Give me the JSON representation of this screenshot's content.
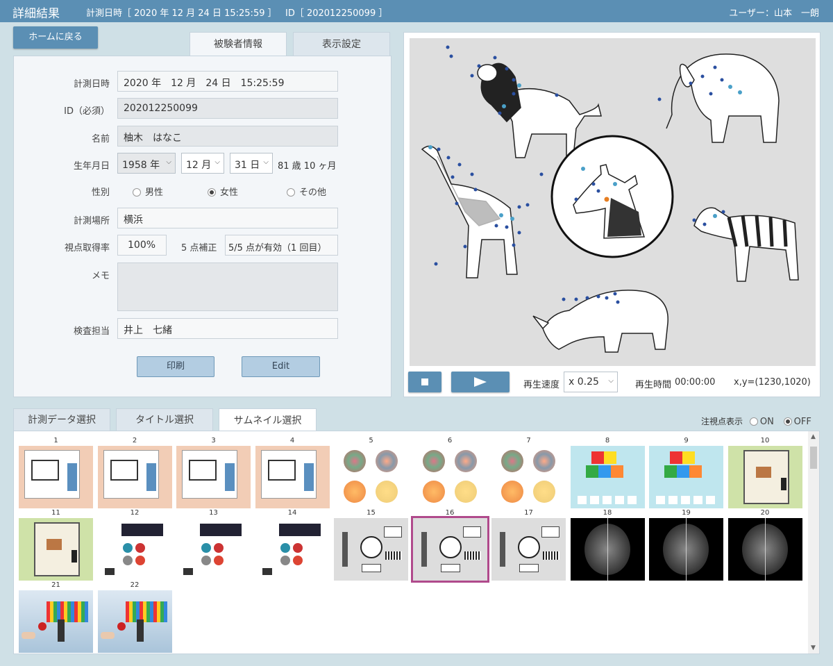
{
  "header": {
    "title": "詳細結果",
    "datetime_label": "計測日時［ 2020 年 12 月 24 日 15:25:59 ］",
    "id_label": "ID［ 202012250099 ］",
    "user_label": "ユーザー：山本　一朗"
  },
  "nav": {
    "home_button": "ホームに戻る"
  },
  "info_tabs": {
    "subject": "被験者情報",
    "display": "表示設定"
  },
  "form": {
    "datetime_label": "計測日時",
    "datetime_value": "2020 年　12 月　24 日　15:25:59",
    "id_label": "ID（必須）",
    "id_value": "202012250099",
    "name_label": "名前",
    "name_value": "柚木　はなこ",
    "birth_label": "生年月日",
    "birth_year": "1958 年",
    "birth_month": "12 月",
    "birth_day": "31 日",
    "age": "81 歳 10 ヶ月",
    "gender_label": "性別",
    "gender_male": "男性",
    "gender_female": "女性",
    "gender_other": "その他",
    "place_label": "計測場所",
    "place_value": "横浜",
    "rate_label": "視点取得率",
    "rate_value": "100%",
    "calib_label": "5 点補正",
    "calib_value": "5/5 点が有効（1 回目）",
    "memo_label": "メモ",
    "memo_value": "",
    "staff_label": "検査担当",
    "staff_value": "井上　七緒",
    "print_button": "印刷",
    "edit_button": "Edit"
  },
  "player": {
    "speed_label": "再生速度",
    "speed_value": "x 0.25",
    "time_label": "再生時間",
    "time_value": "00:00:00",
    "coord_value": "x,y=(1230,1020)"
  },
  "bottom_tabs": {
    "data": "計測データ選択",
    "title": "タイトル選択",
    "thumb": "サムネイル選択"
  },
  "gaze_toggle": {
    "label": "注視点表示",
    "on": "ON",
    "off": "OFF",
    "selected": "OFF"
  },
  "thumbnails": [
    {
      "num": "1"
    },
    {
      "num": "2"
    },
    {
      "num": "3"
    },
    {
      "num": "4"
    },
    {
      "num": "5"
    },
    {
      "num": "6"
    },
    {
      "num": "7"
    },
    {
      "num": "8"
    },
    {
      "num": "9"
    },
    {
      "num": "10"
    },
    {
      "num": "11"
    },
    {
      "num": "12"
    },
    {
      "num": "13"
    },
    {
      "num": "14"
    },
    {
      "num": "15"
    },
    {
      "num": "16"
    },
    {
      "num": "17"
    },
    {
      "num": "18"
    },
    {
      "num": "19"
    },
    {
      "num": "20"
    },
    {
      "num": "21"
    },
    {
      "num": "22"
    }
  ],
  "selected_thumbnail": "16",
  "colors": {
    "header": "#5b8fb4",
    "accent": "#b04a8c",
    "gaze_dot": "#2a4fa0"
  }
}
